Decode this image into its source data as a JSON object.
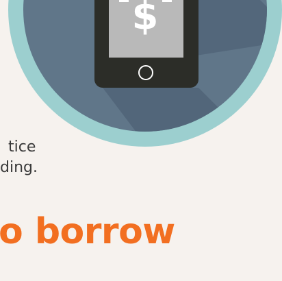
{
  "illustration": {
    "icon": "phone-dollar-icon",
    "dollar_glyph": "$",
    "colors": {
      "ring": "#9ccfcf",
      "circle": "#5b7184",
      "shadow": "#4c5f6f",
      "phone": "#2c2d28",
      "screen": "#b9b9b9"
    }
  },
  "body": {
    "line1": "tice",
    "line2": "ding."
  },
  "heading": {
    "text": "o borrow",
    "color": "#f26f21"
  }
}
